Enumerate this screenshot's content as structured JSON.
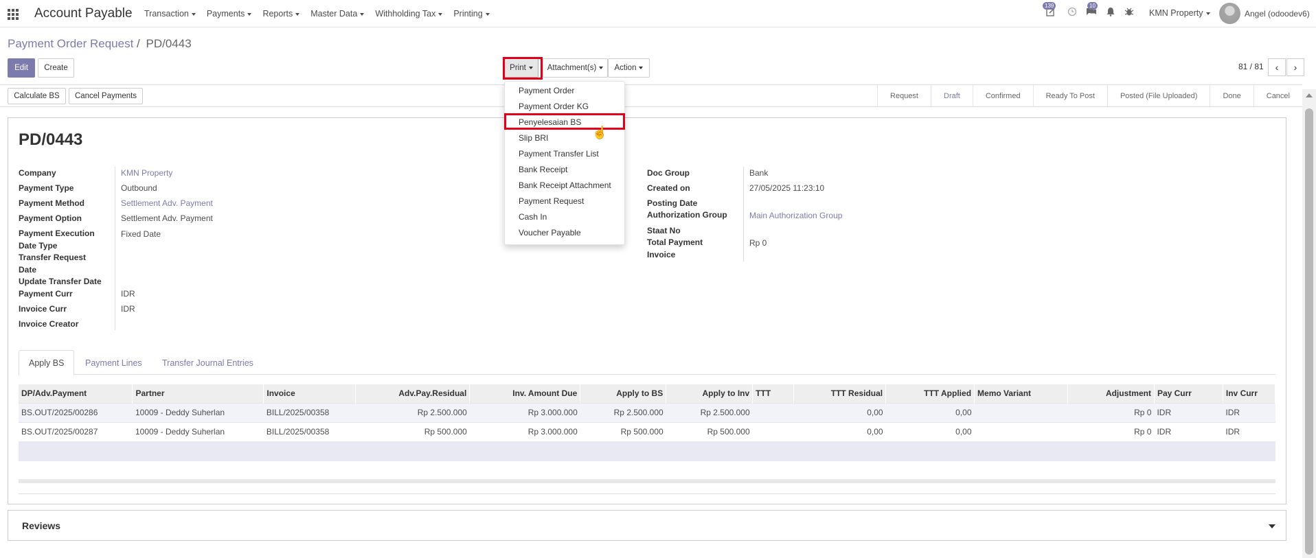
{
  "app": {
    "title": "Account Payable"
  },
  "nav": {
    "menus": [
      {
        "label": "Transaction"
      },
      {
        "label": "Payments"
      },
      {
        "label": "Reports"
      },
      {
        "label": "Master Data"
      },
      {
        "label": "Withholding Tax"
      },
      {
        "label": "Printing"
      }
    ],
    "activity_badge": "139",
    "messages_badge": "10",
    "company": "KMN Property",
    "user": "Angel (odoodev6)"
  },
  "breadcrumb": {
    "parent": "Payment Order Request",
    "separator": "/",
    "current": "PD/0443"
  },
  "toolbar": {
    "edit": "Edit",
    "create": "Create",
    "print": "Print",
    "attachments": "Attachment(s)",
    "action": "Action",
    "pager": "81 / 81"
  },
  "actions": {
    "calculate": "Calculate BS",
    "cancel_payments": "Cancel Payments"
  },
  "stages": [
    "Request",
    "Draft",
    "Confirmed",
    "Ready To Post",
    "Posted (File Uploaded)",
    "Done",
    "Cancel"
  ],
  "active_stage": "Draft",
  "print_menu": [
    "Payment Order",
    "Payment Order KG",
    "Penyelesaian BS",
    "Slip BRI",
    "Payment Transfer List",
    "Bank Receipt",
    "Bank Receipt Attachment",
    "Payment Request",
    "Cash In",
    "Voucher Payable"
  ],
  "print_highlighted": "Penyelesaian BS",
  "record": {
    "name": "PD/0443",
    "left": {
      "company_label": "Company",
      "company": "KMN Property",
      "payment_type_label": "Payment Type",
      "payment_type": "Outbound",
      "payment_method_label": "Payment Method",
      "payment_method": "Settlement Adv. Payment",
      "payment_option_label": "Payment Option",
      "payment_option": "Settlement Adv. Payment",
      "exec_date_type_label": "Payment Execution Date Type",
      "exec_date_type": "Fixed Date",
      "transfer_request_label": "Transfer Request Date",
      "update_transfer_label": "Update Transfer Date",
      "payment_curr_label": "Payment Curr",
      "payment_curr": "IDR",
      "invoice_curr_label": "Invoice Curr",
      "invoice_curr": "IDR",
      "invoice_creator_label": "Invoice Creator"
    },
    "right": {
      "doc_group_label": "Doc Group",
      "doc_group": "Bank",
      "created_on_label": "Created on",
      "created_on": "27/05/2025 11:23:10",
      "posting_date_label": "Posting Date",
      "auth_group_label": "Authorization Group",
      "auth_group": "Main Authorization Group",
      "staat_label": "Staat No",
      "total_payment_label": "Total Payment Invoice",
      "total_payment": "Rp 0"
    }
  },
  "tabs": [
    "Apply BS",
    "Payment Lines",
    "Transfer Journal Entries"
  ],
  "table": {
    "headers": [
      "DP/Adv.Payment",
      "Partner",
      "Invoice",
      "Adv.Pay.Residual",
      "Inv. Amount Due",
      "Apply to BS",
      "Apply to Inv",
      "TTT",
      "TTT Residual",
      "TTT Applied",
      "Memo Variant",
      "Adjustment",
      "Pay Curr",
      "Inv Curr"
    ],
    "rows": [
      [
        "BS.OUT/2025/00286",
        "10009 - Deddy Suherlan",
        "BILL/2025/00358",
        "Rp 2.500.000",
        "Rp 3.000.000",
        "Rp 2.500.000",
        "Rp 2.500.000",
        "",
        "0,00",
        "0,00",
        "",
        "Rp 0",
        "IDR",
        "IDR"
      ],
      [
        "BS.OUT/2025/00287",
        "10009 - Deddy Suherlan",
        "BILL/2025/00358",
        "Rp 500.000",
        "Rp 3.000.000",
        "Rp 500.000",
        "Rp 500.000",
        "",
        "0,00",
        "0,00",
        "",
        "Rp 0",
        "IDR",
        "IDR"
      ]
    ]
  },
  "reviews": {
    "title": "Reviews"
  }
}
